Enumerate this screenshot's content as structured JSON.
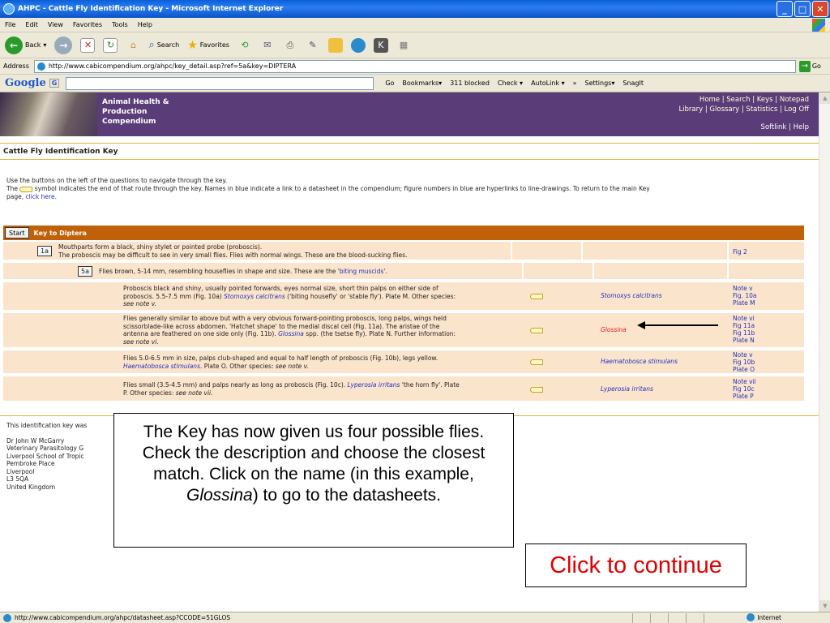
{
  "window": {
    "title": "AHPC - Cattle Fly Identification Key - Microsoft Internet Explorer",
    "min": "_",
    "max": "□",
    "close": "✕"
  },
  "menu": [
    "File",
    "Edit",
    "View",
    "Favorites",
    "Tools",
    "Help"
  ],
  "toolbar": {
    "back": "Back",
    "search": "Search",
    "favorites": "Favorites"
  },
  "address": {
    "label": "Address",
    "url": "http://www.cabicompendium.org/ahpc/key_detail.asp?ref=5a&key=DIPTERA",
    "go": "Go"
  },
  "googlebar": {
    "logo": "Google",
    "g_label": "G",
    "go": "Go",
    "bookmarks": "Bookmarks▾",
    "blocked": "311 blocked",
    "check": "Check ▾",
    "autolink": "AutoLink ▾",
    "more": "»",
    "settings": "Settings▾",
    "snagit": "SnagIt"
  },
  "site": {
    "name1": "Animal Health &",
    "name2": "Production",
    "name3": "Compendium",
    "nav1": "Home   |   Search   |   Keys   |   Notepad",
    "nav2": "Library   |   Glossary   |  Statistics  |  Log Off",
    "softlink": "Softlink | Help"
  },
  "page": {
    "title": "Cattle Fly Identification Key",
    "intro1": "Use the buttons on the left of the questions to navigate through the key.",
    "intro2a": "The",
    "intro2b": "symbol indicates the end of that route through the key. Names in blue indicate a link to a datasheet in the compendium; figure numbers in blue are hyperlinks to line-drawings. To return to the main Key",
    "intro3": "page,",
    "intro3_link": "click here",
    "intro3_end": "."
  },
  "key": {
    "start": "Start",
    "title": "Key to Diptera",
    "row1": {
      "step": "1a",
      "text1": "Mouthparts form a black, shiny stylet or pointed probe (proboscis).",
      "text2": "The proboscis may be difficult to see in very small flies. Flies with normal wings. These are the blood-sucking flies.",
      "fig": "Fig 2"
    },
    "row2": {
      "step": "5a",
      "text": "Flies brown, 5-14 mm, resembling houseflies in shape and size. These are the",
      "link": "'biting muscids'",
      "end": "."
    },
    "row3": {
      "t1": "Proboscis black and shiny, usually pointed forwards, eyes normal size, short thin palps on either side of",
      "t2a": "proboscis. 5.5-7.5 mm (Fig. 10a)",
      "t2b": "Stomoxys calcitrans",
      "t2c": "('biting housefly' or 'stable fly'). Plate M. Other species:",
      "t3": "see note v.",
      "name": "Stomoxys calcitrans",
      "fig1": "Note v",
      "fig2": "Fig. 10a",
      "fig3": "Plate M"
    },
    "row4": {
      "t1": "Flies generally similar to above but with a very obvious forward-pointing proboscis, long palps, wings held",
      "t2": "scissorblade-like across abdomen. 'Hatchet shape' to the medial discal cell (Fig. 11a). The aristae of the",
      "t3a": "antenna are feathered on one side only (Fig. 11b).",
      "t3b": "Glossina",
      "t3c": "spp. (the tsetse fly). Plate N. Further information:",
      "t4": "see note vi.",
      "name": "Glossina",
      "fig1": "Note vi",
      "fig2": "Fig 11a",
      "fig3": "Fig 11b",
      "fig4": "Plate N"
    },
    "row5": {
      "t1": "Flies 5.0-6.5 mm in size, palps club-shaped and equal to half length of proboscis (Fig. 10b), legs yellow.",
      "t2a": "Haematobosca stimulans",
      "t2b": ". Plate O. Other species:",
      "t2c": "see note v.",
      "name": "Haematobosca stimulans",
      "fig1": "Note v",
      "fig2": "Fig 10b",
      "fig3": "Plate O"
    },
    "row6": {
      "t1a": "Flies small (3.5-4.5 mm) and palps nearly as long as proboscis (Fig. 10c).",
      "t1b": "Lyperosia irritans",
      "t1c": "'the horn fly'. Plate",
      "t2a": "P. Other species:",
      "t2b": "see note vii.",
      "name": "Lyperosia irritans",
      "fig1": "Note vii",
      "fig2": "Fig 10c",
      "fig3": "Plate P"
    }
  },
  "footer": {
    "l1": "This identification key was",
    "l2": "Dr John W McGarry",
    "l3": "Veterinary Parasitology G",
    "l4": "Liverpool School of Tropic",
    "l5": "Pembroke Place",
    "l6": "Liverpool",
    "l7": "L3 5QA",
    "l8": "United Kingdom"
  },
  "callout": {
    "text1": "The Key has now given us four possible flies.  Check the description and choose the closest match.  Click on the name (in this example, ",
    "italic": "Glossina",
    "text2": ") to go to the datasheets."
  },
  "continue": "Click to continue",
  "status": {
    "url": "http://www.cabicompendium.org/ahpc/datasheet.asp?CCODE=51GLOS",
    "zone": "Internet"
  },
  "colors": {
    "header": "#5a3c78",
    "keybar": "#c0610a",
    "row_bg": "#fbe4cc",
    "link": "#2233bb",
    "highlight": "#dd2222"
  }
}
